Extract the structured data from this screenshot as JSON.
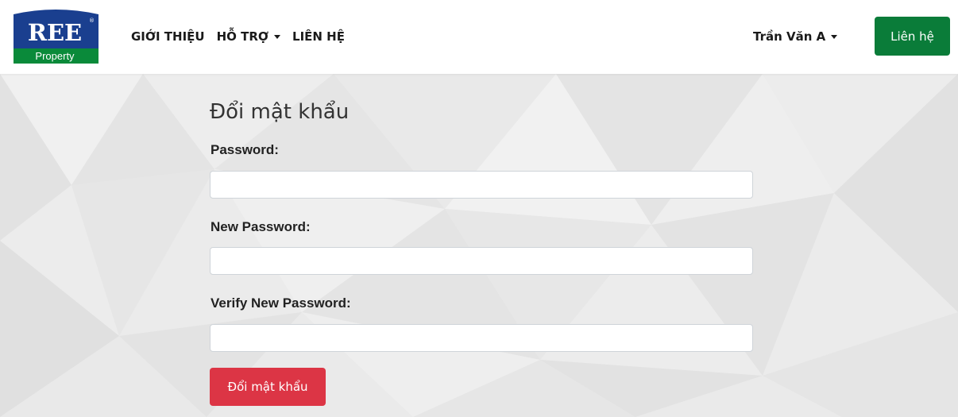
{
  "brand": {
    "logo_top_text": "REE",
    "logo_bottom_text": "Property",
    "logo_mark": "®",
    "logo_color": "#1a3f8f",
    "logo_band_color": "#0a8a3a"
  },
  "nav": {
    "items": [
      {
        "label": "GIỚI THIỆU",
        "has_dropdown": false
      },
      {
        "label": "HỖ TRỢ",
        "has_dropdown": true
      },
      {
        "label": "LIÊN HỆ",
        "has_dropdown": false
      }
    ]
  },
  "user": {
    "name": "Trần Văn A",
    "icon": "chevron-down-icon"
  },
  "header": {
    "contact_button_label": "Liên hệ",
    "contact_button_color": "#0a7c39"
  },
  "form": {
    "title": "Đổi mật khẩu",
    "fields": [
      {
        "label": "Password:",
        "value": "",
        "placeholder": ""
      },
      {
        "label": "New Password:",
        "value": "",
        "placeholder": ""
      },
      {
        "label": "Verify New Password:",
        "value": "",
        "placeholder": ""
      }
    ],
    "submit_label": "Đổi mật khẩu",
    "submit_color": "#dc3545"
  }
}
